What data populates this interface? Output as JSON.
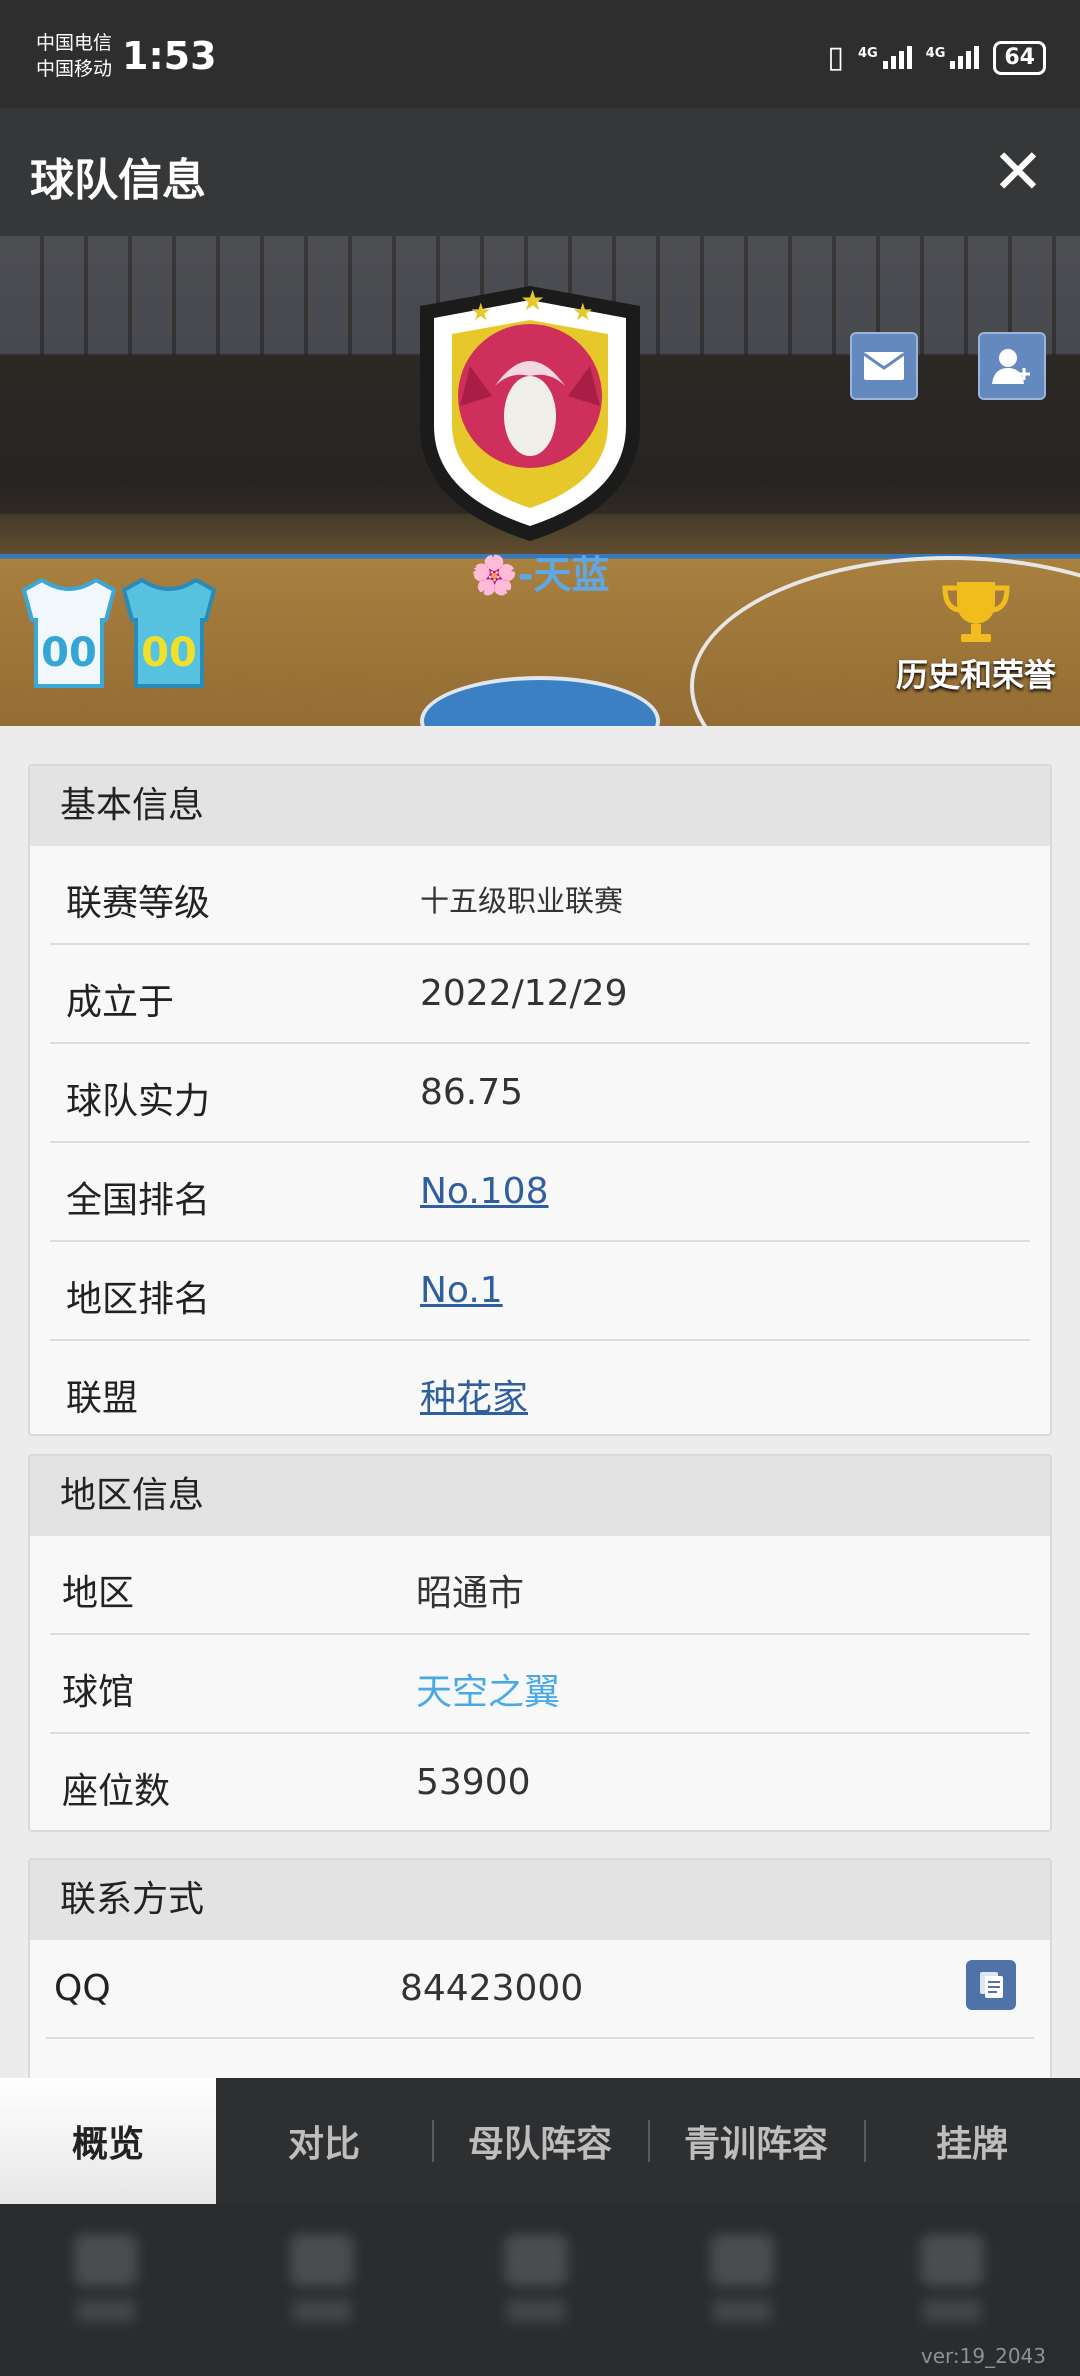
{
  "status_bar": {
    "carrier_1": "中国电信",
    "carrier_2": "中国移动",
    "time": "1:53",
    "net_1": "4G",
    "net_2": "4G",
    "battery": "64"
  },
  "header": {
    "title": "球队信息"
  },
  "banner": {
    "team_name": "🌸-天蓝",
    "jersey_home_number": "00",
    "jersey_away_number": "00",
    "honor_label": "历史和荣誉"
  },
  "basic_info": {
    "title": "基本信息",
    "rows": [
      {
        "label": "联赛等级",
        "value": "十五级职业联赛"
      },
      {
        "label": "成立于",
        "value": "2022/12/29"
      },
      {
        "label": "球队实力",
        "value": "86.75"
      },
      {
        "label": "全国排名",
        "value": "No.108"
      },
      {
        "label": "地区排名",
        "value": "No.1"
      },
      {
        "label": "联盟",
        "value": "种花家"
      }
    ]
  },
  "region_info": {
    "title": "地区信息",
    "rows": [
      {
        "label": "地区",
        "value": "昭通市"
      },
      {
        "label": "球馆",
        "value": "天空之翼"
      },
      {
        "label": "座位数",
        "value": "53900"
      }
    ]
  },
  "contact": {
    "title": "联系方式",
    "rows": [
      {
        "label": "QQ",
        "value": "84423000"
      }
    ]
  },
  "tabs": [
    "概览",
    "对比",
    "母队阵容",
    "青训阵容",
    "挂牌"
  ],
  "active_tab": "概览",
  "version": "ver:19_2043",
  "colors": {
    "header_bg": "#353739",
    "link": "#2f5f9e",
    "venue_link": "#48a9e6",
    "team_name": "#5fa8e8",
    "button_blue": "#6389bf"
  }
}
